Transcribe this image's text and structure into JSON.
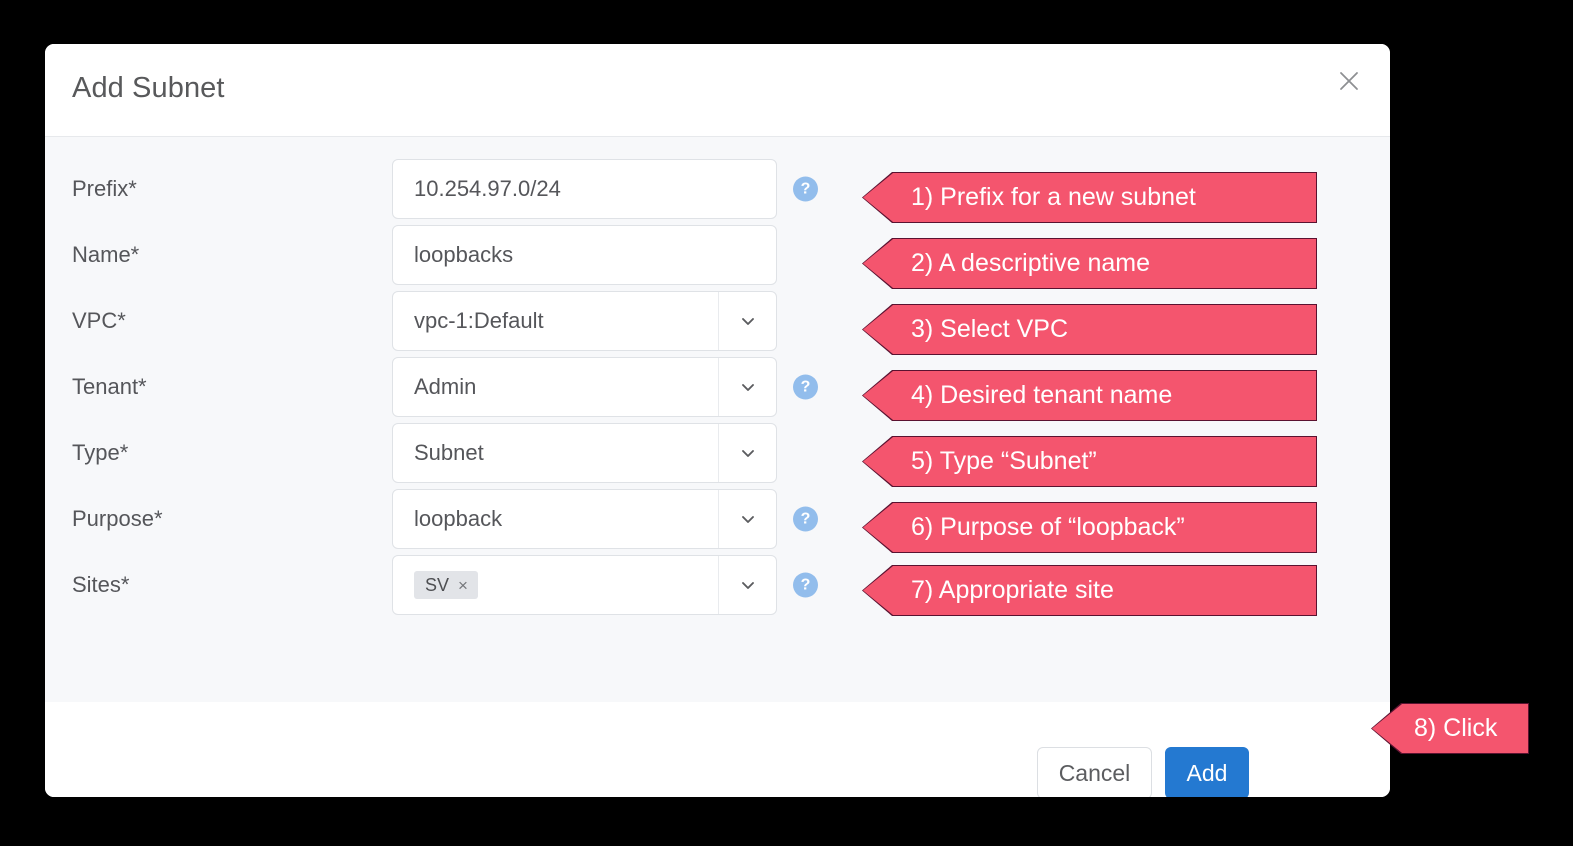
{
  "colors": {
    "accent_red": "#F4556E",
    "primary_blue": "#2479D1",
    "help_badge_blue": "#92BDEC",
    "body_bg": "#F7F8FA",
    "backdrop": "#000000"
  },
  "modal": {
    "title": "Add Subnet",
    "close_icon": "close-icon",
    "fields": [
      {
        "label": "Prefix*",
        "name": "prefix",
        "control": "text",
        "value": "10.254.97.0/24",
        "has_help": true
      },
      {
        "label": "Name*",
        "name": "name",
        "control": "text",
        "value": "loopbacks",
        "has_help": false
      },
      {
        "label": "VPC*",
        "name": "vpc",
        "control": "select",
        "value": "vpc-1:Default",
        "has_help": false
      },
      {
        "label": "Tenant*",
        "name": "tenant",
        "control": "select",
        "value": "Admin",
        "has_help": true
      },
      {
        "label": "Type*",
        "name": "type",
        "control": "select",
        "value": "Subnet",
        "has_help": false
      },
      {
        "label": "Purpose*",
        "name": "purpose",
        "control": "select",
        "value": "loopback",
        "has_help": true
      },
      {
        "label": "Sites*",
        "name": "sites",
        "control": "multiselect",
        "value": "",
        "token": "SV",
        "token_remove": "×",
        "has_help": true
      }
    ],
    "help_badge_label": "?",
    "footer": {
      "cancel_label": "Cancel",
      "add_label": "Add"
    }
  },
  "annotations": [
    {
      "text": "1) Prefix for a new subnet"
    },
    {
      "text": "2) A descriptive name"
    },
    {
      "text": "3) Select VPC"
    },
    {
      "text": "4) Desired tenant name"
    },
    {
      "text": "5) Type “Subnet”"
    },
    {
      "text": "6) Purpose of “loopback”"
    },
    {
      "text": "7) Appropriate site"
    },
    {
      "text": "8) Click"
    }
  ]
}
